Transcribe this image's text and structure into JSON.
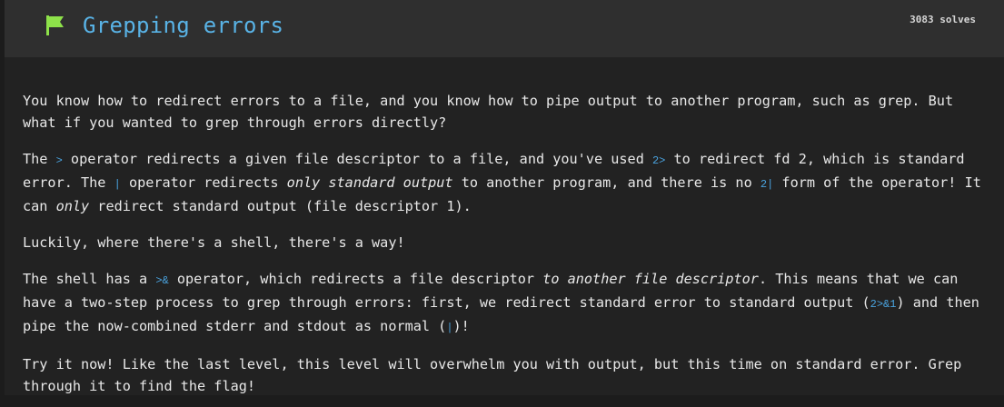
{
  "header": {
    "title": "Grepping errors",
    "solves": "3083 solves",
    "flag_icon": "flag-icon",
    "flag_color": "#8ee24a",
    "title_color": "#59b3e6"
  },
  "description": {
    "p1": "You know how to redirect errors to a file, and you know how to pipe output to another program, such as grep. But what if you wanted to grep through errors directly?",
    "p2": {
      "t1": "The ",
      "c1": ">",
      "t2": " operator redirects a given file descriptor to a file, and you've used ",
      "c2": "2>",
      "t3": " to redirect fd 2, which is standard error. The ",
      "c3": "|",
      "t4": " operator redirects ",
      "e1": "only standard output",
      "t5": " to another program, and there is no ",
      "c4": "2|",
      "t6": " form of the operator! It can ",
      "e2": "only",
      "t7": " redirect standard output (file descriptor 1)."
    },
    "p3": "Luckily, where there's a shell, there's a way!",
    "p4": {
      "t1": "The shell has a ",
      "c1": ">&",
      "t2": " operator, which redirects a file descriptor ",
      "e1": "to another file descriptor",
      "t3": ". This means that we can have a two-step process to grep through errors: first, we redirect standard error to standard output (",
      "c2": "2>&1",
      "t4": ") and then pipe the now-combined stderr and stdout as normal (",
      "c3": "|",
      "t5": ")!"
    },
    "p5": "Try it now! Like the last level, this level will overwhelm you with output, but this time on standard error. Grep through it to find the flag!"
  }
}
